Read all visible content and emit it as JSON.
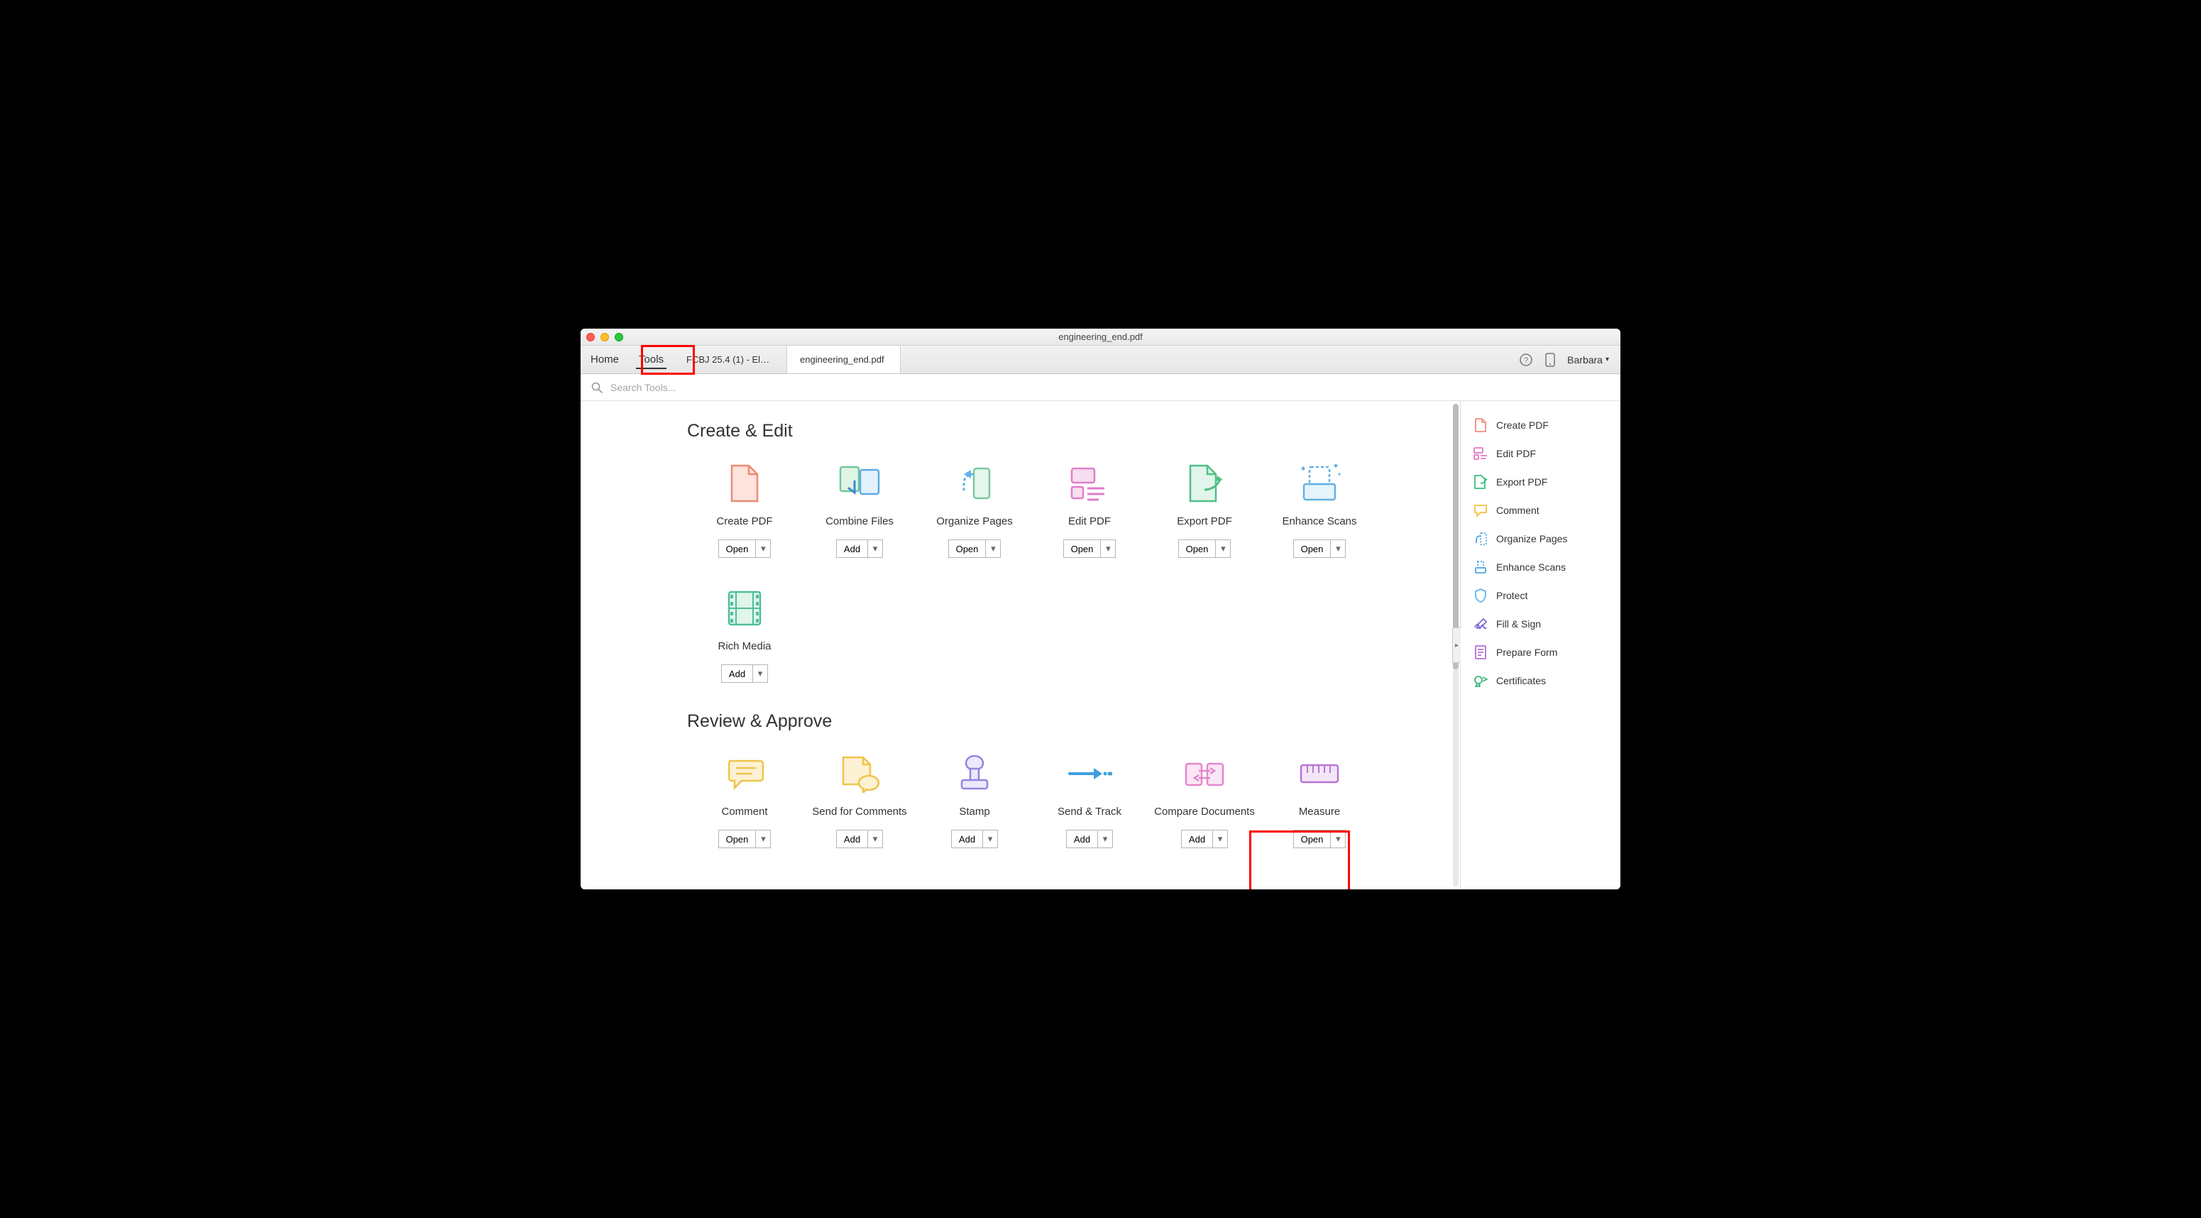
{
  "window_title": "engineering_end.pdf",
  "toolbar": {
    "home": "Home",
    "tools": "Tools",
    "doc_tabs": [
      "FCBJ 25.4 (1) - El…",
      "engineering_end.pdf"
    ],
    "user": "Barbara"
  },
  "search": {
    "placeholder": "Search Tools..."
  },
  "sections": [
    {
      "title": "Create & Edit",
      "tools": [
        {
          "label": "Create PDF",
          "btn": "Open",
          "icon": "create-pdf"
        },
        {
          "label": "Combine Files",
          "btn": "Add",
          "icon": "combine"
        },
        {
          "label": "Organize Pages",
          "btn": "Open",
          "icon": "organize"
        },
        {
          "label": "Edit PDF",
          "btn": "Open",
          "icon": "edit-pdf"
        },
        {
          "label": "Export PDF",
          "btn": "Open",
          "icon": "export"
        },
        {
          "label": "Enhance Scans",
          "btn": "Open",
          "icon": "enhance"
        },
        {
          "label": "Rich Media",
          "btn": "Add",
          "icon": "media"
        }
      ]
    },
    {
      "title": "Review & Approve",
      "tools": [
        {
          "label": "Comment",
          "btn": "Open",
          "icon": "comment"
        },
        {
          "label": "Send for Comments",
          "btn": "Add",
          "icon": "send-comments"
        },
        {
          "label": "Stamp",
          "btn": "Add",
          "icon": "stamp"
        },
        {
          "label": "Send & Track",
          "btn": "Add",
          "icon": "send-track"
        },
        {
          "label": "Compare Documents",
          "btn": "Add",
          "icon": "compare"
        },
        {
          "label": "Measure",
          "btn": "Open",
          "icon": "measure"
        }
      ]
    }
  ],
  "sidepanel": [
    {
      "label": "Create PDF",
      "icon": "create-pdf",
      "color": "#ef8f7a"
    },
    {
      "label": "Edit PDF",
      "icon": "edit-pdf",
      "color": "#e574c3"
    },
    {
      "label": "Export PDF",
      "icon": "export",
      "color": "#35c17a"
    },
    {
      "label": "Comment",
      "icon": "comment",
      "color": "#f2c23d"
    },
    {
      "label": "Organize Pages",
      "icon": "organize",
      "color": "#4fa8e0"
    },
    {
      "label": "Enhance Scans",
      "icon": "enhance",
      "color": "#4fa8e0"
    },
    {
      "label": "Protect",
      "icon": "protect",
      "color": "#5bb9e8"
    },
    {
      "label": "Fill & Sign",
      "icon": "sign",
      "color": "#7b68d8"
    },
    {
      "label": "Prepare Form",
      "icon": "form",
      "color": "#b46fd1"
    },
    {
      "label": "Certificates",
      "icon": "cert",
      "color": "#3fb680"
    }
  ]
}
